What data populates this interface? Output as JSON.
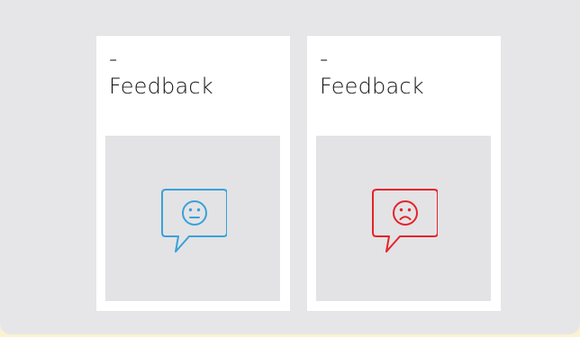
{
  "cards": [
    {
      "prefix": "-",
      "title": "Feedback",
      "icon": "neutral-feedback-icon",
      "icon_color": "#3aa1d8"
    },
    {
      "prefix": "-",
      "title": "Feedback",
      "icon": "negative-feedback-icon",
      "icon_color": "#e3232a"
    }
  ],
  "colors": {
    "background": "#e6e6e8",
    "card": "#ffffff",
    "media": "#e3e3e5",
    "accent_strip": "#fbf2d4"
  }
}
